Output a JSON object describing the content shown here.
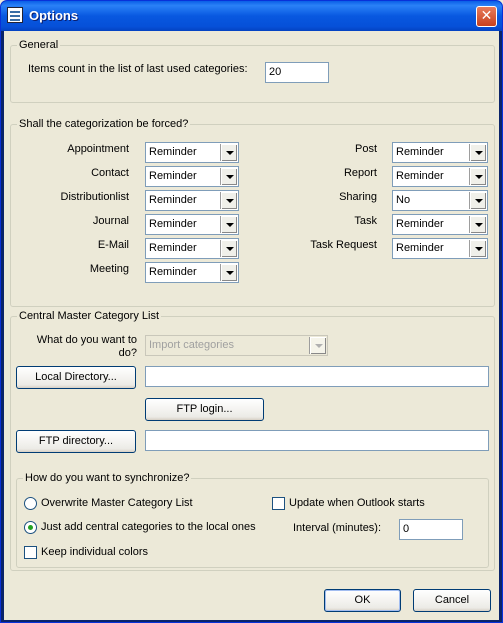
{
  "window": {
    "title": "Options",
    "close_glyph": "✕"
  },
  "general": {
    "legend": "General",
    "items_count_label": "Items count in the list of last used categories:",
    "items_count_value": "20"
  },
  "forced": {
    "legend": "Shall the categorization be forced?",
    "left": [
      {
        "label": "Appointment",
        "value": "Reminder"
      },
      {
        "label": "Contact",
        "value": "Reminder"
      },
      {
        "label": "Distributionlist",
        "value": "Reminder"
      },
      {
        "label": "Journal",
        "value": "Reminder"
      },
      {
        "label": "E-Mail",
        "value": "Reminder"
      },
      {
        "label": "Meeting",
        "value": "Reminder"
      }
    ],
    "right": [
      {
        "label": "Post",
        "value": "Reminder"
      },
      {
        "label": "Report",
        "value": "Reminder"
      },
      {
        "label": "Sharing",
        "value": "No"
      },
      {
        "label": "Task",
        "value": "Reminder"
      },
      {
        "label": "Task Request",
        "value": "Reminder"
      }
    ]
  },
  "central": {
    "legend": "Central Master Category List",
    "what_label": "What do you want to do?",
    "what_value": "Import categories",
    "local_dir_button": "Local Directory...",
    "local_dir_value": "",
    "ftp_login_button": "FTP login...",
    "ftp_dir_button": "FTP directory...",
    "ftp_dir_value": ""
  },
  "sync": {
    "legend": "How do you want to synchronize?",
    "overwrite_label": "Overwrite Master Category List",
    "just_add_label": "Just add central categories to the local ones",
    "keep_colors_label": "Keep individual colors",
    "update_label": "Update when Outlook starts",
    "interval_label": "Interval (minutes):",
    "interval_value": "0"
  },
  "footer": {
    "ok_label": "OK",
    "cancel_label": "Cancel"
  }
}
